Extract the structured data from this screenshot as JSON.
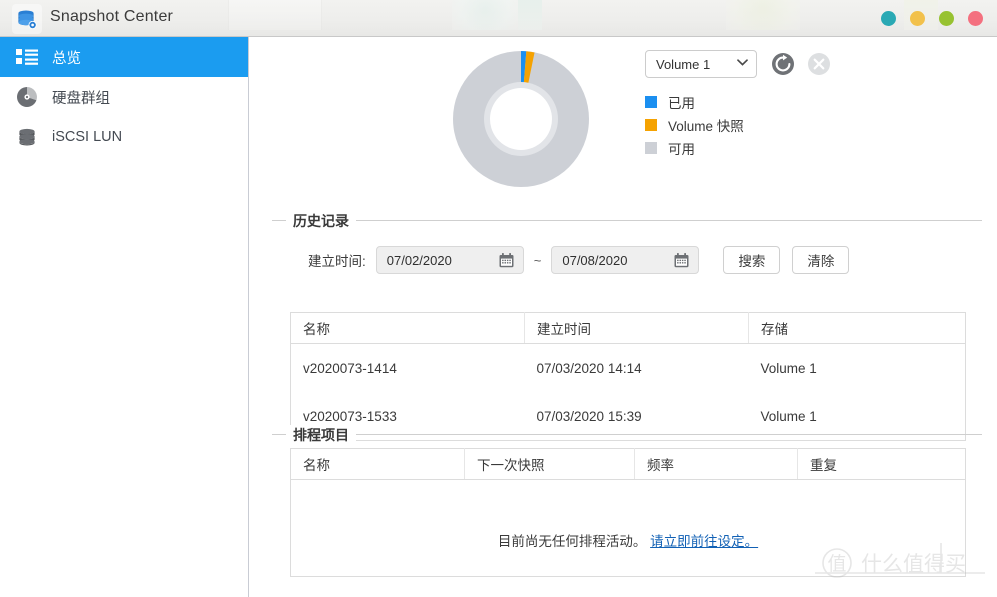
{
  "window": {
    "title": "Snapshot Center",
    "app_icon": "database-stack-icon",
    "controls": [
      {
        "name": "minimize-to-tray-button",
        "color": "#2aa9b4"
      },
      {
        "name": "minimize-button",
        "color": "#f2c14b"
      },
      {
        "name": "maximize-button",
        "color": "#97c231"
      },
      {
        "name": "close-button",
        "color": "#f4707f"
      }
    ]
  },
  "sidebar": {
    "items": [
      {
        "label": "总览",
        "icon": "overview-list-icon",
        "active": true
      },
      {
        "label": "硬盘群组",
        "icon": "disk-group-icon",
        "active": false
      },
      {
        "label": "iSCSI LUN",
        "icon": "iscsi-lun-icon",
        "active": false
      }
    ]
  },
  "overview": {
    "volume_select": {
      "value": "Volume 1",
      "caret": "chevron-down-icon"
    },
    "refresh_icon": "refresh-icon",
    "cancel_icon": "cancel-icon",
    "legend": [
      {
        "label": "已用",
        "color": "#1b8ff0"
      },
      {
        "label": "Volume 快照",
        "color": "#f5a201"
      },
      {
        "label": "可用",
        "color": "#cdd0d6"
      }
    ]
  },
  "chart_data": {
    "type": "pie",
    "title": "",
    "labels": [
      "已用",
      "Volume 快照",
      "可用"
    ],
    "values": [
      1.4,
      2.1,
      96.5
    ],
    "colors": [
      "#1b8ff0",
      "#f5a201",
      "#cdd0d6"
    ],
    "donut": true,
    "inner_radius_ratio": 0.45,
    "start_angle_deg": 0,
    "legend_position": "right",
    "grid": false
  },
  "history": {
    "title": "历史记录",
    "date_label": "建立时间:",
    "date_from": "07/02/2020",
    "date_to": "07/08/2020",
    "date_placeholder": "MM/DD/YYYY",
    "range_separator": "~",
    "calendar_icon": "calendar-icon",
    "search_button": "搜索",
    "clear_button": "清除",
    "columns": [
      "名称",
      "建立时间",
      "存储"
    ],
    "rows": [
      {
        "name": "v2020073-1414",
        "created": "07/03/2020 14:14",
        "storage": "Volume 1"
      },
      {
        "name": "v2020073-1533",
        "created": "07/03/2020 15:39",
        "storage": "Volume 1"
      }
    ]
  },
  "schedule": {
    "title": "排程项目",
    "columns": [
      "名称",
      "下一次快照",
      "频率",
      "重复"
    ],
    "rows": [],
    "empty_text": "目前尚无任何排程活动。",
    "empty_link": "请立即前往设定。"
  },
  "watermark": {
    "text": "什么值得买",
    "badge": "值"
  }
}
